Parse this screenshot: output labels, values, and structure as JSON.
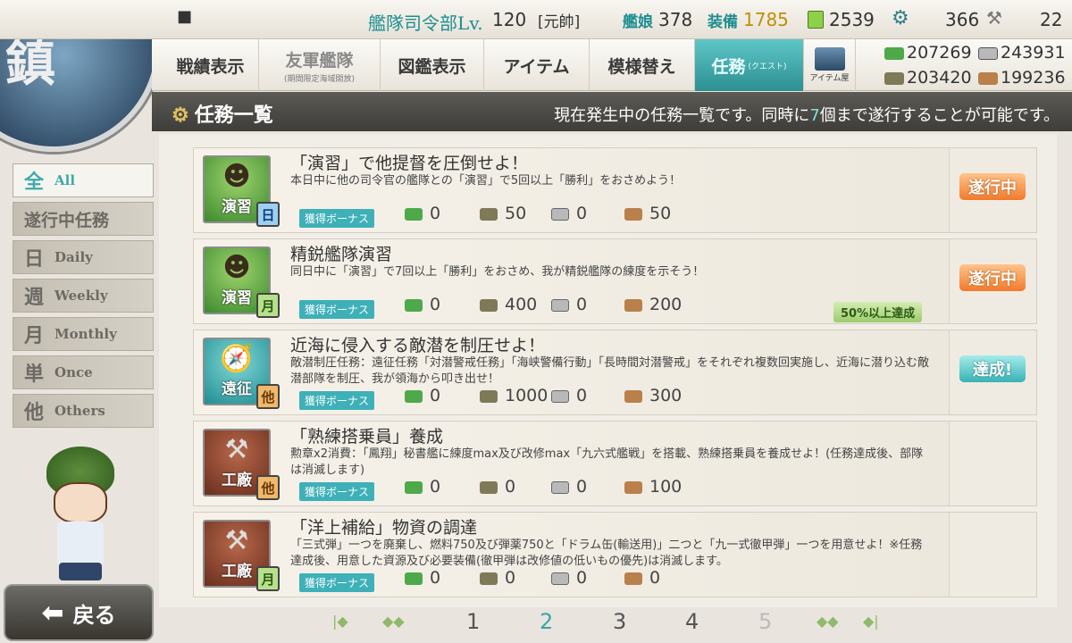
{
  "emblem_text": "鎮",
  "status": {
    "hq_label": "艦隊司令部Lv.",
    "hq_level": "120",
    "rank": "[元帥]",
    "ships_label": "艦娘",
    "ships": "378",
    "equip_label": "装備",
    "equip": "1785",
    "bucket": "2539",
    "dev_material": "366",
    "screws": "22"
  },
  "nav": {
    "items": [
      {
        "label": "戦績表示"
      },
      {
        "label": "友軍艦隊",
        "sub": "(期間限定海域開放)"
      },
      {
        "label": "図鑑表示"
      },
      {
        "label": "アイテム"
      },
      {
        "label": "模様替え"
      },
      {
        "label": "任務",
        "sub": "(クエスト)"
      }
    ],
    "shop_label": "アイテム屋"
  },
  "resources": {
    "fuel": "207269",
    "ammo": "203420",
    "steel": "243931",
    "bauxite": "199236"
  },
  "header": {
    "title": "任務一覧",
    "msg_pre": "現在発生中の任務一覧です。同時に",
    "msg_num": "7",
    "msg_post": "個まで遂行することが可能です。"
  },
  "filters": [
    {
      "kanji": "全",
      "en": "All"
    },
    {
      "kanji": "遂行中任務",
      "en": ""
    },
    {
      "kanji": "日",
      "en": "Daily"
    },
    {
      "kanji": "週",
      "en": "Weekly"
    },
    {
      "kanji": "月",
      "en": "Monthly"
    },
    {
      "kanji": "単",
      "en": "Once"
    },
    {
      "kanji": "他",
      "en": "Others"
    }
  ],
  "quests": [
    {
      "category": "演習",
      "freq": "日",
      "title": "「演習」で他提督を圧倒せよ！",
      "desc": "本日中に他の司令官の艦隊との「演習」で5回以上「勝利」をおさめよう！",
      "bonus": "獲得ボーナス",
      "fuel": "0",
      "ammo": "50",
      "steel": "0",
      "baux": "50",
      "status": "遂行中",
      "progress": ""
    },
    {
      "category": "演習",
      "freq": "月",
      "title": "精鋭艦隊演習",
      "desc": "同日中に「演習」で7回以上「勝利」をおさめ、我が精鋭艦隊の練度を示そう！",
      "bonus": "獲得ボーナス",
      "fuel": "0",
      "ammo": "400",
      "steel": "0",
      "baux": "200",
      "status": "遂行中",
      "progress": "50%以上達成"
    },
    {
      "category": "遠征",
      "freq": "他",
      "title": "近海に侵入する敵潜を制圧せよ！",
      "desc": "敵潜制圧任務：遠征任務「対潜警戒任務」「海峡警備行動」「長時間対潜警戒」をそれぞれ複数回実施し、近海に潜り込む敵潜部隊を制圧、我が領海から叩き出せ！",
      "bonus": "獲得ボーナス",
      "fuel": "0",
      "ammo": "1000",
      "steel": "0",
      "baux": "300",
      "status": "達成!",
      "progress": ""
    },
    {
      "category": "工廠",
      "freq": "他",
      "title": "「熟練搭乗員」養成",
      "desc": "勲章x2消費：「鳳翔」秘書艦に練度max及び改修max「九六式艦戦」を搭載、熟練搭乗員を養成せよ！(任務達成後、部隊は消滅します)",
      "bonus": "獲得ボーナス",
      "fuel": "0",
      "ammo": "0",
      "steel": "0",
      "baux": "100",
      "status": "",
      "progress": ""
    },
    {
      "category": "工廠",
      "freq": "月",
      "title": "「洋上補給」物資の調達",
      "desc": "「三式弾」一つを廃棄し、燃料750及び弾薬750と「ドラム缶(輸送用)」二つと「九一式徹甲弾」一つを用意せよ！※任務達成後、用意した資源及び必要装備(徹甲弾は改修値の低いもの優先)は消滅します。",
      "bonus": "獲得ボーナス",
      "fuel": "0",
      "ammo": "0",
      "steel": "0",
      "baux": "0",
      "status": "",
      "progress": ""
    }
  ],
  "pagination": {
    "pages": [
      "1",
      "2",
      "3",
      "4",
      "5"
    ],
    "current": "2"
  },
  "back_label": "戻る",
  "colors": {
    "accent": "#3eaaaa",
    "in_progress": "#f07a2c",
    "complete": "#38b2b4"
  }
}
